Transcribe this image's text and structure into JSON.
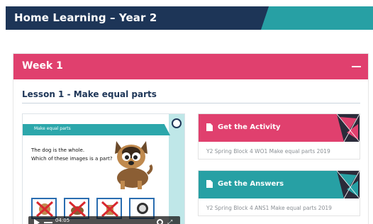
{
  "header": {
    "title": "Home Learning – Year 2"
  },
  "week": {
    "title": "Week 1"
  },
  "lesson": {
    "title": "Lesson 1 - Make equal parts"
  },
  "video": {
    "banner": "Make equal parts",
    "text_line1": "The dog is the whole.",
    "text_line2": "Which of these images is a part?",
    "time": "04:05"
  },
  "cards": {
    "activity": {
      "label": "Get the Activity",
      "file": "Y2 Spring Block 4 WO1 Make equal parts 2019"
    },
    "answers": {
      "label": "Get the Answers",
      "file": "Y2 Spring Block 4 ANS1 Make equal parts 2019"
    }
  },
  "colors": {
    "navy": "#1d3557",
    "teal": "#27a0a4",
    "pink": "#e0406e"
  }
}
